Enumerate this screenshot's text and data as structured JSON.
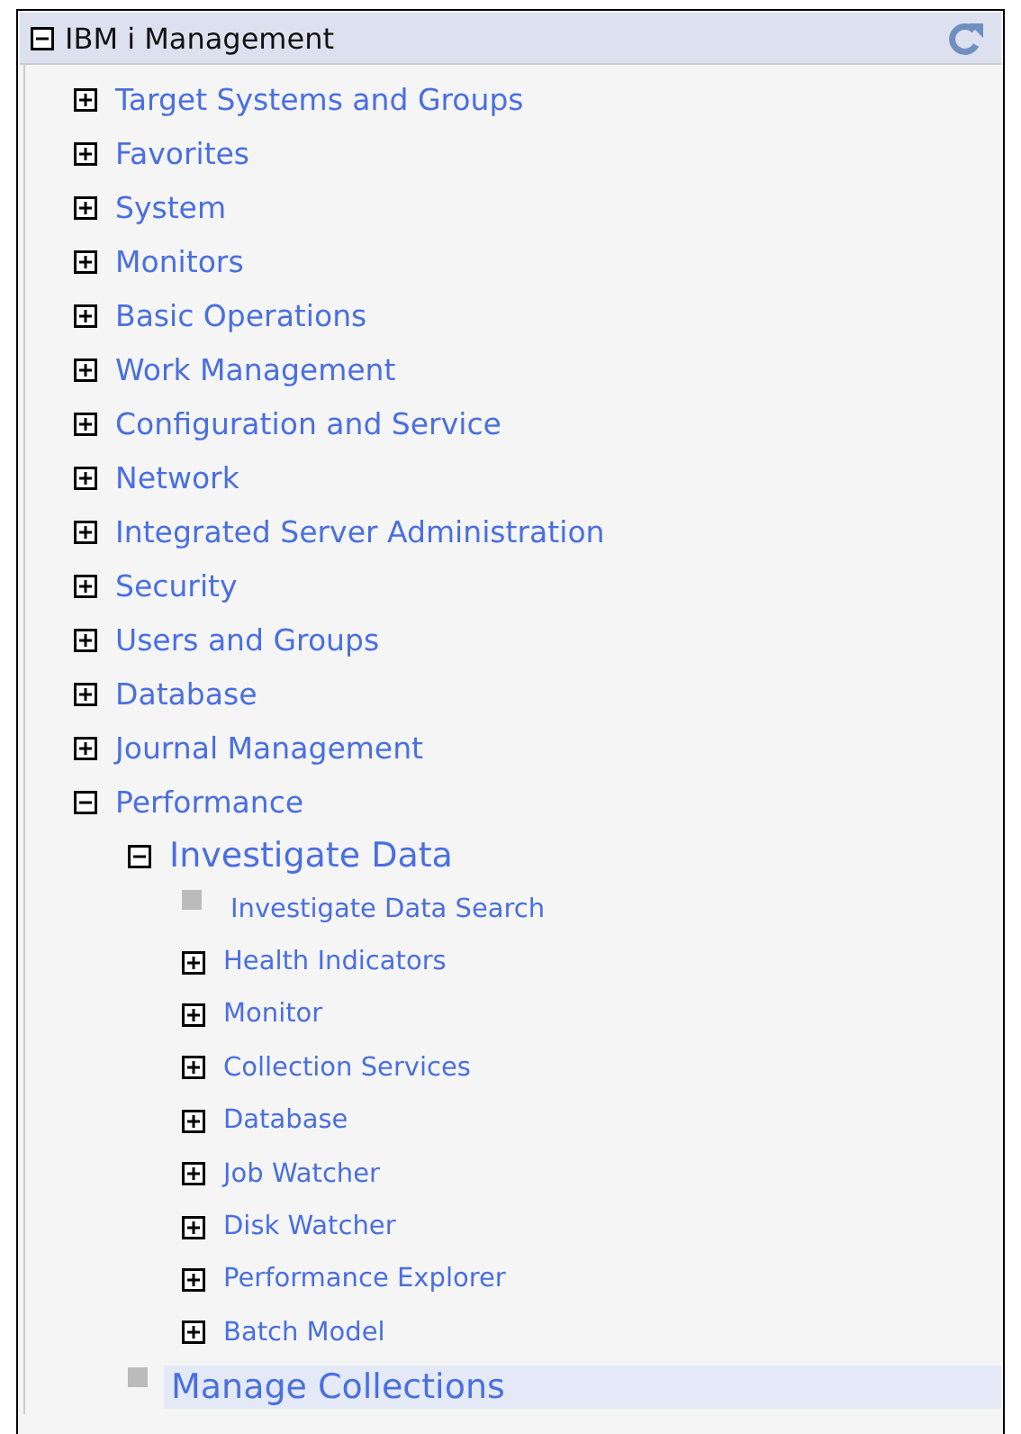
{
  "tree": {
    "title": "IBM i Management",
    "expanded": true,
    "children": [
      {
        "kind": "node",
        "label": "Target Systems and Groups",
        "expanded": false,
        "selected": false
      },
      {
        "kind": "node",
        "label": "Favorites",
        "expanded": false,
        "selected": false
      },
      {
        "kind": "node",
        "label": "System",
        "expanded": false,
        "selected": false
      },
      {
        "kind": "node",
        "label": "Monitors",
        "expanded": false,
        "selected": false
      },
      {
        "kind": "node",
        "label": "Basic Operations",
        "expanded": false,
        "selected": false
      },
      {
        "kind": "node",
        "label": "Work Management",
        "expanded": false,
        "selected": false
      },
      {
        "kind": "node",
        "label": "Configuration and Service",
        "expanded": false,
        "selected": false
      },
      {
        "kind": "node",
        "label": "Network",
        "expanded": false,
        "selected": false
      },
      {
        "kind": "node",
        "label": "Integrated Server Administration",
        "expanded": false,
        "selected": false
      },
      {
        "kind": "node",
        "label": "Security",
        "expanded": false,
        "selected": false
      },
      {
        "kind": "node",
        "label": "Users and Groups",
        "expanded": false,
        "selected": false
      },
      {
        "kind": "node",
        "label": "Database",
        "expanded": false,
        "selected": false
      },
      {
        "kind": "node",
        "label": "Journal Management",
        "expanded": false,
        "selected": false
      },
      {
        "kind": "node",
        "label": "Performance",
        "expanded": true,
        "selected": false,
        "children": [
          {
            "kind": "node",
            "label": "Investigate Data",
            "expanded": true,
            "selected": false,
            "children": [
              {
                "kind": "leaf",
                "label": "Investigate Data Search",
                "selected": false
              },
              {
                "kind": "node",
                "label": "Health Indicators",
                "expanded": false,
                "selected": false
              },
              {
                "kind": "node",
                "label": "Monitor",
                "expanded": false,
                "selected": false
              },
              {
                "kind": "node",
                "label": "Collection Services",
                "expanded": false,
                "selected": false
              },
              {
                "kind": "node",
                "label": "Database",
                "expanded": false,
                "selected": false
              },
              {
                "kind": "node",
                "label": "Job Watcher",
                "expanded": false,
                "selected": false
              },
              {
                "kind": "node",
                "label": "Disk Watcher",
                "expanded": false,
                "selected": false
              },
              {
                "kind": "node",
                "label": "Performance Explorer",
                "expanded": false,
                "selected": false
              },
              {
                "kind": "node",
                "label": "Batch Model",
                "expanded": false,
                "selected": false
              }
            ]
          },
          {
            "kind": "leaf",
            "label": "Manage Collections",
            "selected": true
          }
        ]
      }
    ]
  }
}
